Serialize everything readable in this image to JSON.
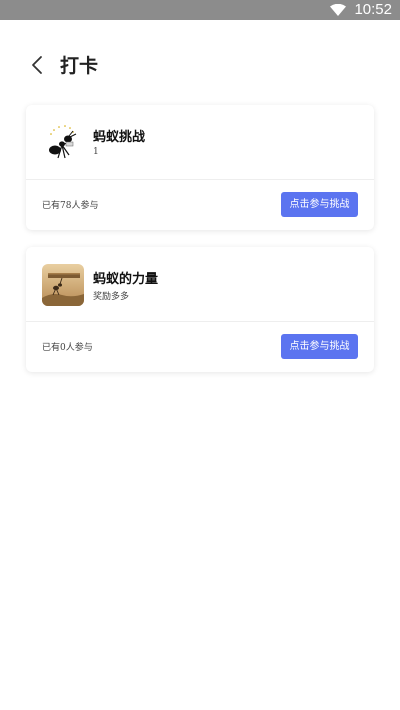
{
  "status_bar": {
    "time": "10:52",
    "wifi_icon": "wifi-icon"
  },
  "header": {
    "title": "打卡",
    "back_icon": "chevron-left-icon"
  },
  "accent_color": "#5b74f0",
  "challenges": [
    {
      "name": "蚂蚁挑战",
      "subtitle": "1",
      "participants": "已有78人参与",
      "button": "点击参与挑战",
      "image": "ant-illustration"
    },
    {
      "name": "蚂蚁的力量",
      "subtitle": "奖励多多",
      "participants": "已有0人参与",
      "button": "点击参与挑战",
      "image": "ant-photo"
    }
  ]
}
